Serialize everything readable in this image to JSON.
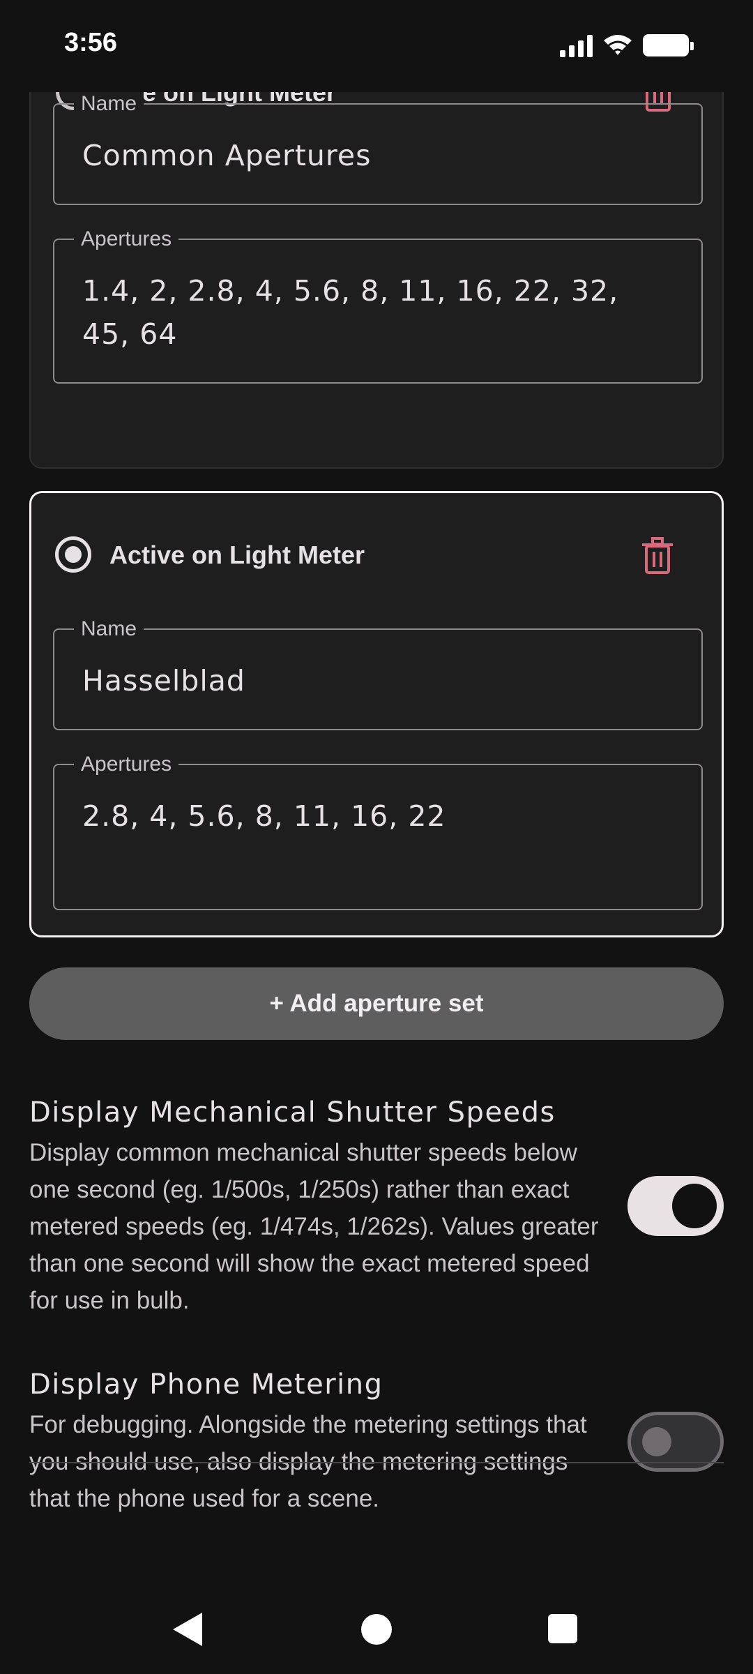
{
  "status_bar": {
    "time": "3:56",
    "icons": [
      "signal-icon",
      "wifi-icon",
      "battery-icon"
    ]
  },
  "aperture_sets": [
    {
      "radio_label": "Use on Light Meter",
      "selected": false,
      "name_label": "Name",
      "name_value": "Common Apertures",
      "apertures_label": "Apertures",
      "apertures_value": "1.4, 2, 2.8, 4, 5.6, 8, 11, 16, 22, 32, 45, 64"
    },
    {
      "radio_label": "Active on Light Meter",
      "selected": true,
      "name_label": "Name",
      "name_value": "Hasselblad",
      "apertures_label": "Apertures",
      "apertures_value": "2.8, 4, 5.6, 8, 11, 16, 22"
    }
  ],
  "add_button_label": "+ Add aperture set",
  "settings": [
    {
      "title": "Display Mechanical Shutter Speeds",
      "description": "Display common mechanical shutter speeds below one second (eg. 1/500s, 1/250s) rather than exact metered speeds (eg. 1/474s, 1/262s). Values greater than one second will show the exact metered speed for use in bulb.",
      "enabled": true
    },
    {
      "title": "Display Phone Metering",
      "description": "For debugging. Alongside the metering settings that you should use, also display the metering settings that the phone used for a scene.",
      "enabled": false
    }
  ],
  "colors": {
    "background": "#121212",
    "card": "#1e1e1e",
    "delete_icon": "#d86a7e",
    "button": "#5e5e5e"
  },
  "nav_bar": [
    "back-icon",
    "home-icon",
    "recents-icon"
  ]
}
